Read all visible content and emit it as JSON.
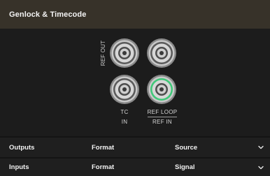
{
  "header": {
    "title": "Genlock & Timecode"
  },
  "connectors": {
    "ref_out_label": "REF OUT",
    "tc_label": "TC",
    "in_label": "IN",
    "ref_loop_label": "REF LOOP",
    "ref_in_label": "REF IN",
    "active_ring_color": "#3ec878"
  },
  "rows": [
    {
      "label": "Outputs",
      "col2": "Format",
      "col3": "Source"
    },
    {
      "label": "Inputs",
      "col2": "Format",
      "col3": "Signal"
    }
  ]
}
